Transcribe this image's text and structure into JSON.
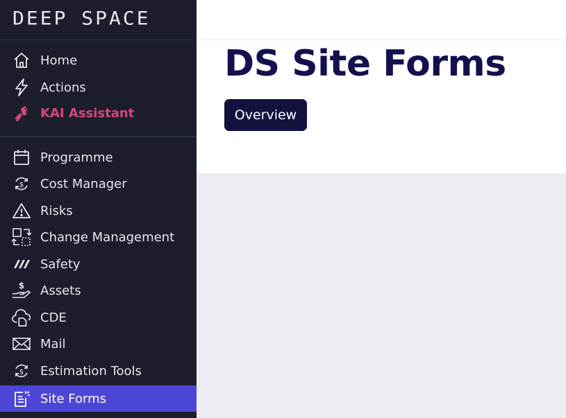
{
  "brand": {
    "logo_text": "DEEP SPACE"
  },
  "sidebar": {
    "items": [
      {
        "label": "Home",
        "icon": "home-icon"
      },
      {
        "label": "Actions",
        "icon": "lightning-icon"
      },
      {
        "label": "KAI Assistant",
        "icon": "robot-icon"
      },
      {
        "label": "Programme",
        "icon": "calendar-icon"
      },
      {
        "label": "Cost Manager",
        "icon": "cost-cycle-icon"
      },
      {
        "label": "Risks",
        "icon": "warning-icon"
      },
      {
        "label": "Change Management",
        "icon": "change-icon"
      },
      {
        "label": "Safety",
        "icon": "safety-stripes-icon"
      },
      {
        "label": "Assets",
        "icon": "hand-dollar-icon"
      },
      {
        "label": "CDE",
        "icon": "cloud-doc-icon"
      },
      {
        "label": "Mail",
        "icon": "mail-icon"
      },
      {
        "label": "Estimation Tools",
        "icon": "estimation-cycle-icon"
      },
      {
        "label": "Site Forms",
        "icon": "site-forms-icon"
      }
    ],
    "active_item": "Site Forms"
  },
  "main": {
    "title": "DS Site Forms",
    "tabs": [
      {
        "label": "Overview",
        "active": true
      }
    ]
  },
  "colors": {
    "sidebar_bg": "#1c1e2d",
    "active_item_bg": "#4c46d6",
    "kai_accent": "#d4487a",
    "title_color": "#13104e",
    "tab_bg": "#13113e",
    "content_bg": "#edeef3"
  }
}
